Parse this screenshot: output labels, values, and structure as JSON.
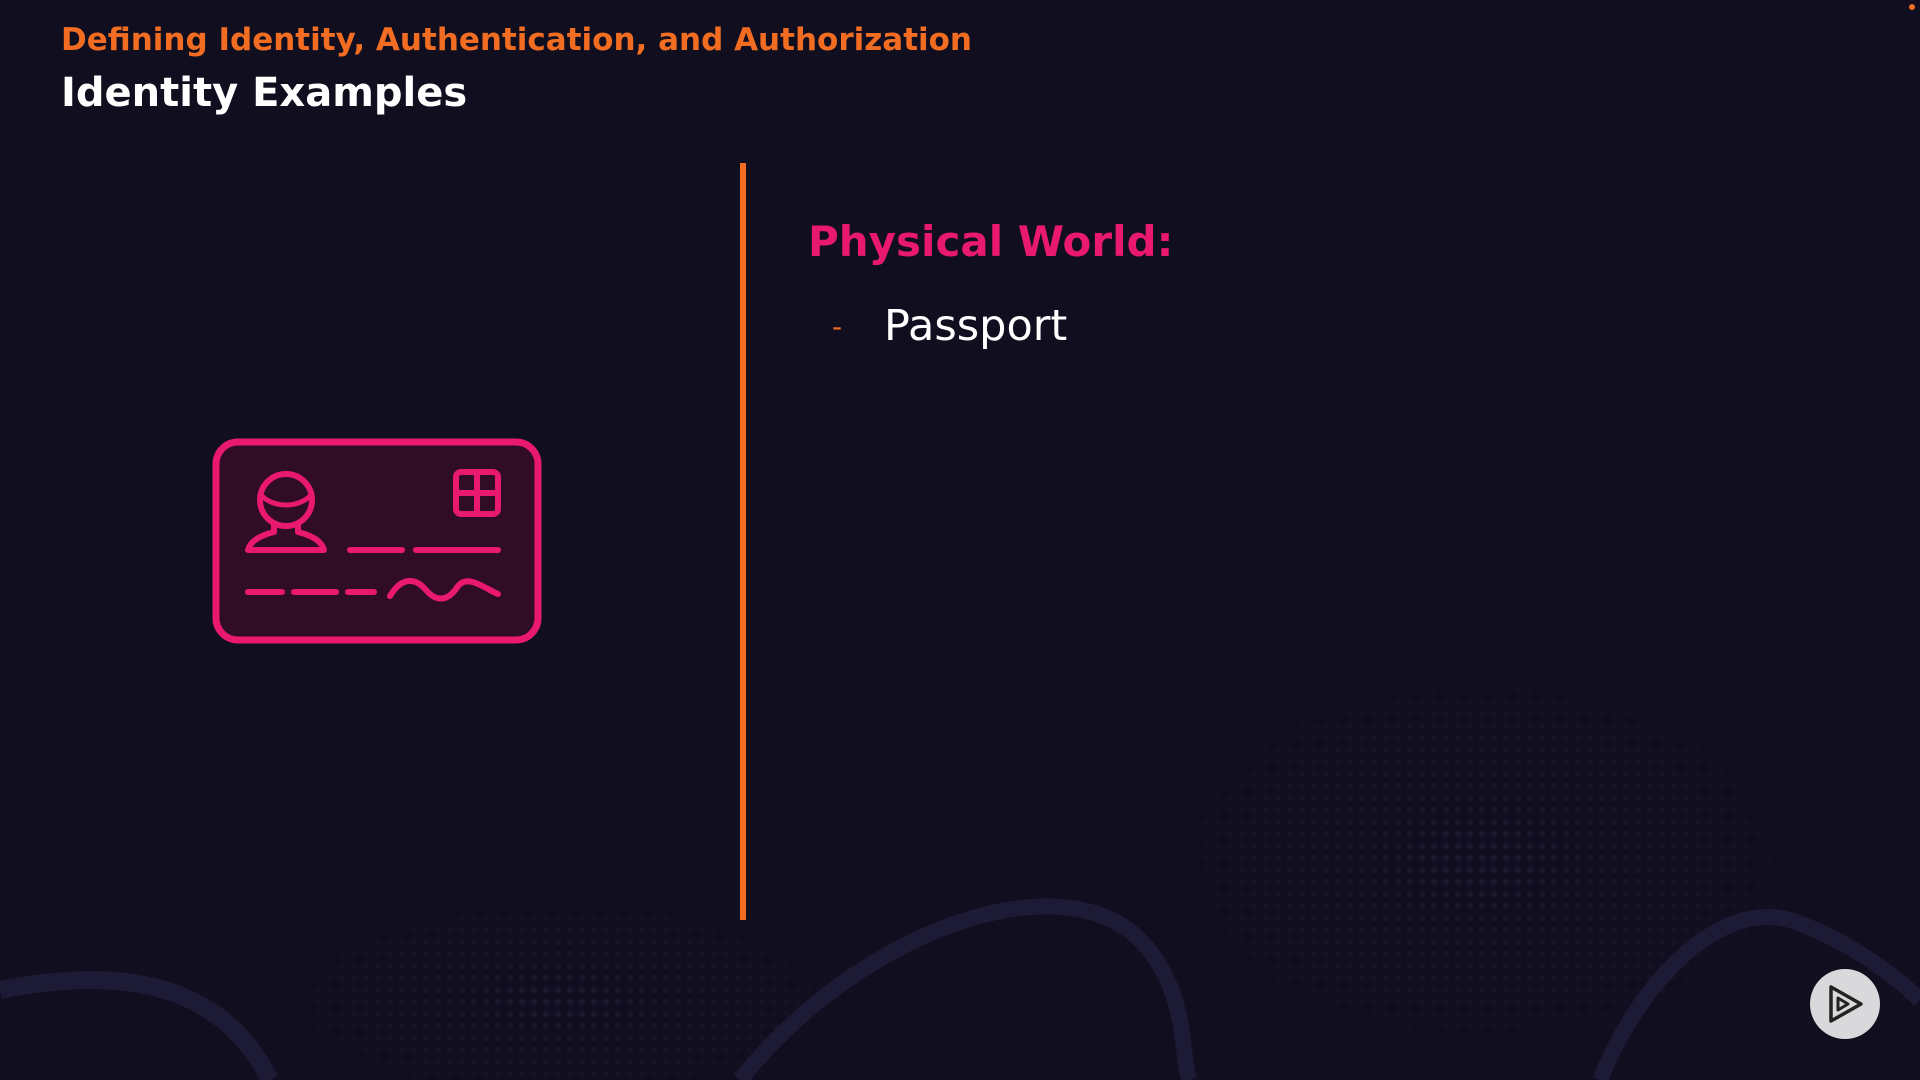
{
  "header": {
    "course_title": "Defining Identity, Authentication, and Authorization",
    "slide_title": "Identity Examples"
  },
  "content": {
    "section_heading": "Physical World:",
    "bullets": [
      {
        "dash": "-",
        "text": "Passport"
      }
    ]
  },
  "illustration": {
    "icon": "id-card-icon"
  },
  "branding": {
    "icon": "play-logo-icon"
  },
  "colors": {
    "background": "#110f1f",
    "accent_orange": "#f26d21",
    "accent_pink": "#e8196e",
    "text_white": "#ffffff"
  }
}
